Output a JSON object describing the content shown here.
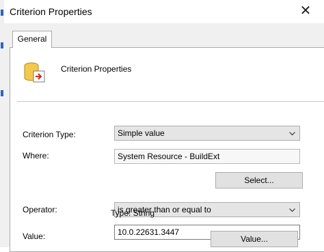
{
  "window": {
    "title": "Criterion Properties"
  },
  "tabs": [
    {
      "label": "General"
    }
  ],
  "header": {
    "text": "Criterion Properties"
  },
  "form": {
    "criterion_type_label": "Criterion Type:",
    "criterion_type_value": "Simple value",
    "where_label": "Where:",
    "where_value": "System Resource - BuildExt",
    "select_button": "Select...",
    "operator_label": "Operator:",
    "operator_value": "is greater than or equal to",
    "value_label": "Value:",
    "value_value": "10.0.22631.3447",
    "type_text": "Type: String",
    "value_button": "Value..."
  },
  "icons": {
    "close": "close-icon",
    "header": "criterion-icon",
    "dropdown": "chevron-down-icon"
  }
}
